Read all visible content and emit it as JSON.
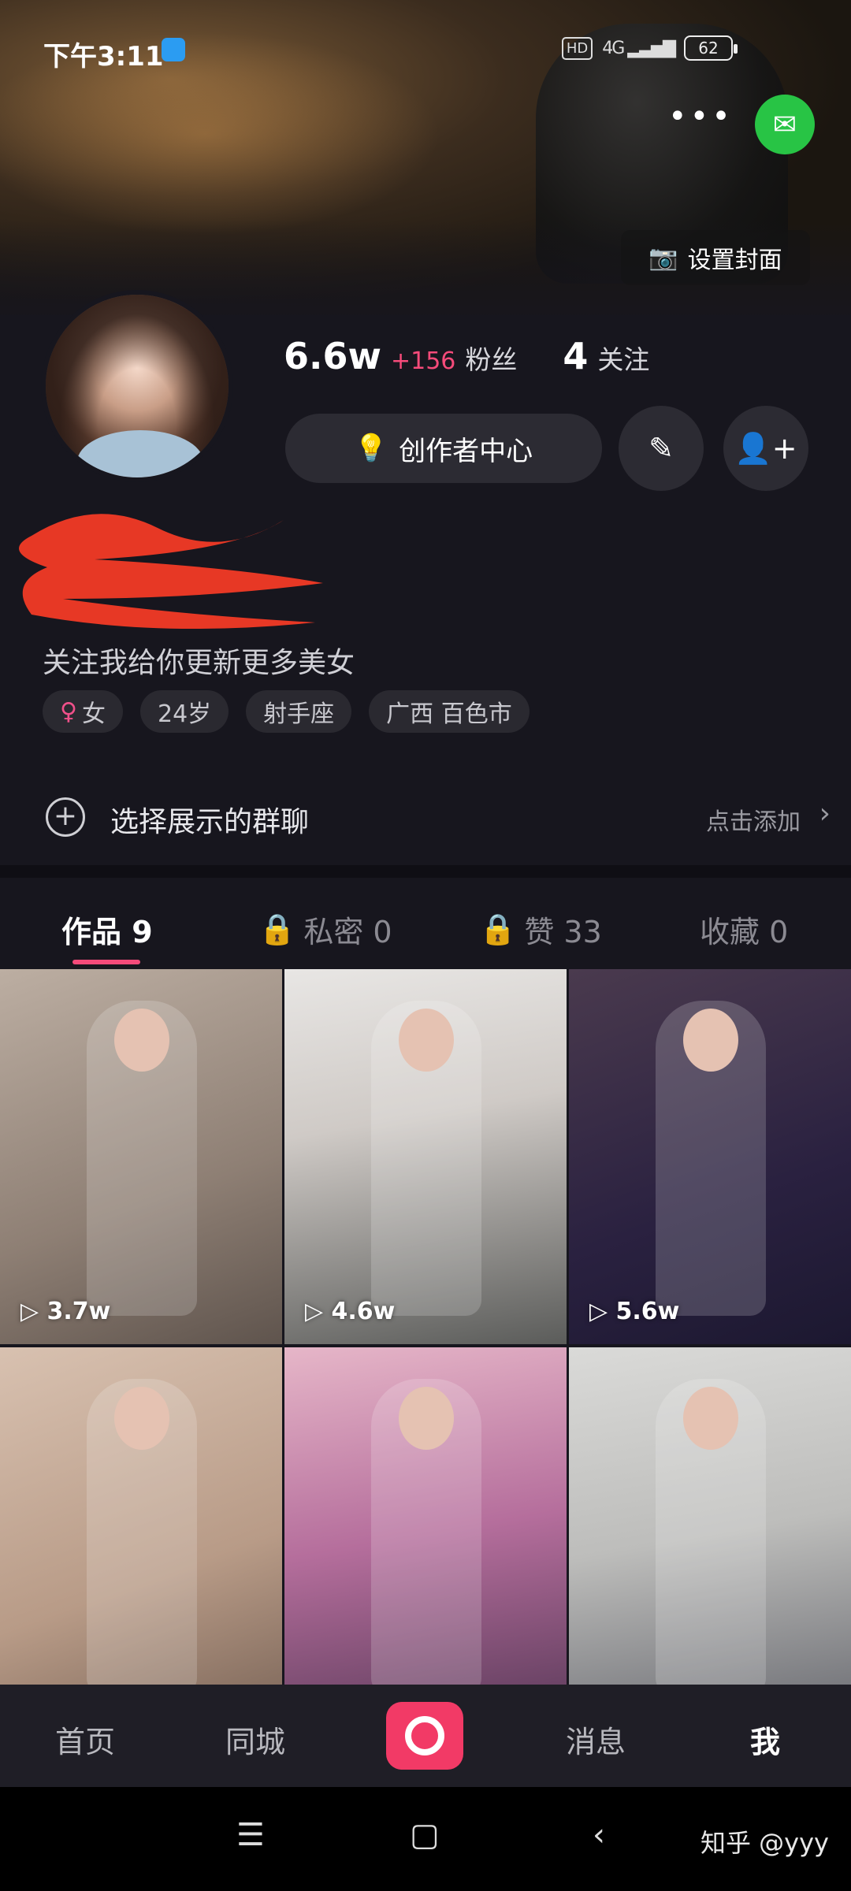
{
  "status_bar": {
    "time": "下午3:11",
    "hd": "HD",
    "network": "4G",
    "battery": "62"
  },
  "header": {
    "set_cover_label": "设置封面",
    "more_icon": "•••"
  },
  "profile": {
    "fans_count": "6.6w",
    "fans_delta": "+156",
    "fans_label": "粉丝",
    "following_count": "4",
    "following_label": "关注",
    "creator_center_label": "创作者中心",
    "bio": "关注我给你更新更多美女",
    "tags": {
      "gender": "女",
      "age": "24岁",
      "zodiac": "射手座",
      "location": "广西 百色市"
    }
  },
  "group_chat": {
    "label": "选择展示的群聊",
    "action": "点击添加"
  },
  "tabs": {
    "works": "作品 9",
    "private": "私密 0",
    "likes": "赞 33",
    "favorites": "收藏 0"
  },
  "videos": [
    {
      "views": "3.7w"
    },
    {
      "views": "4.6w"
    },
    {
      "views": "5.6w"
    }
  ],
  "bottom_nav": {
    "home": "首页",
    "city": "同城",
    "messages": "消息",
    "me": "我"
  },
  "watermark": "知乎 @yyy",
  "colors": {
    "accent": "#f54b7a",
    "background": "#17161e",
    "wechat": "#28c445",
    "record": "#f23a66"
  }
}
